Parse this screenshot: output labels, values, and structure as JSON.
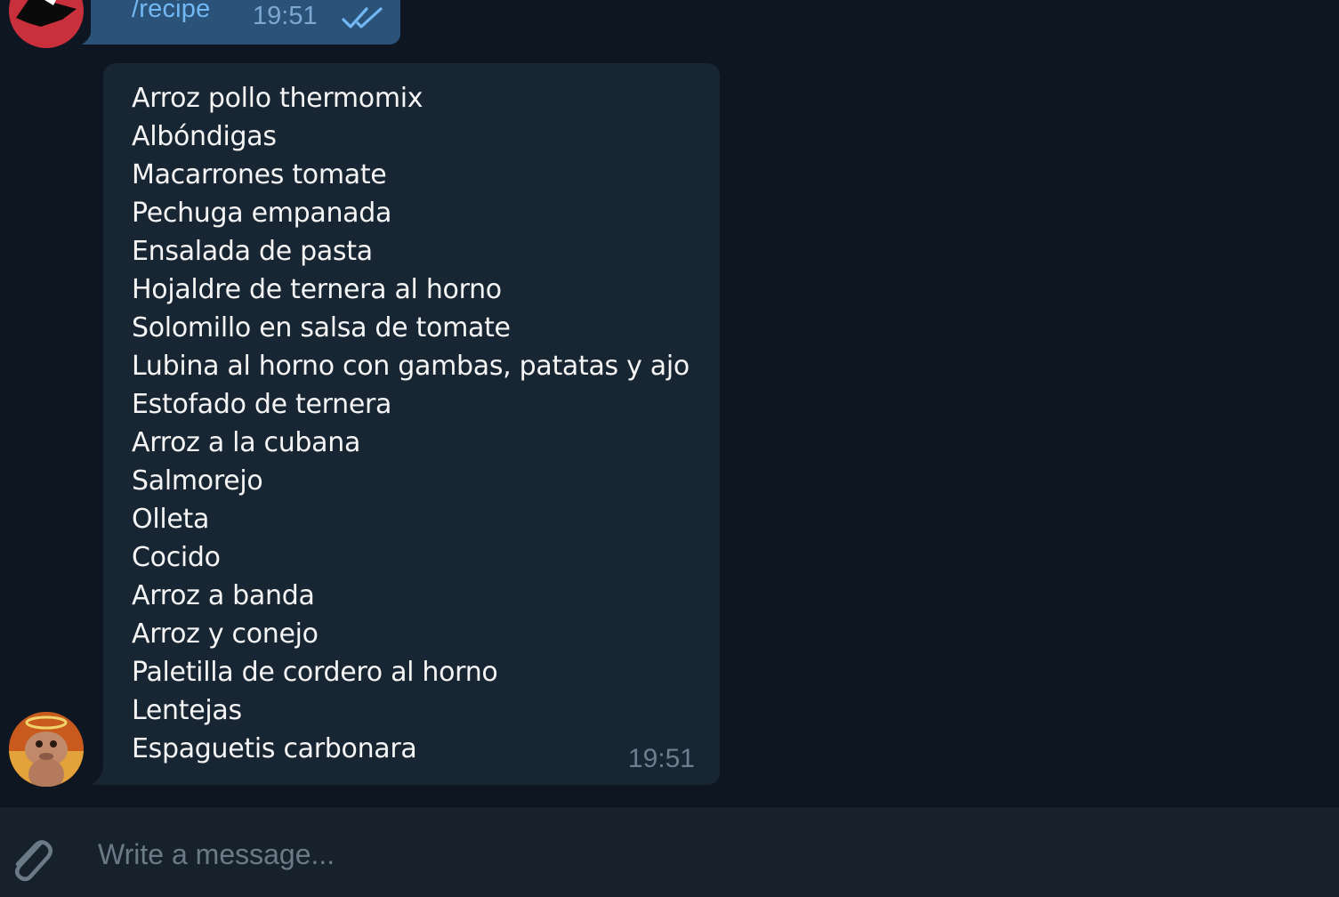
{
  "messages": {
    "outgoing": {
      "text": "/recipe",
      "time": "19:51",
      "status_icon": "double-check-icon"
    },
    "incoming": {
      "items": [
        "Arroz pollo thermomix",
        "Albóndigas",
        "Macarrones tomate",
        "Pechuga empanada",
        "Ensalada de pasta",
        "Hojaldre de ternera al horno",
        "Solomillo en salsa de tomate",
        "Lubina al horno con gambas, patatas y ajo",
        "Estofado de ternera",
        "Arroz a la cubana",
        "Salmorejo",
        "Olleta",
        "Cocido",
        "Arroz a banda",
        "Arroz y conejo",
        "Paletilla de cordero al horno",
        "Lentejas",
        "Espaguetis carbonara"
      ],
      "time": "19:51"
    }
  },
  "composer": {
    "placeholder": "Write a message...",
    "value": "",
    "attach_icon": "paperclip-icon"
  },
  "colors": {
    "chat_background": "#0e1621",
    "outgoing_bubble": "#2b5278",
    "incoming_bubble": "#182533",
    "composer_background": "#17212b",
    "command_link": "#71b8f5",
    "message_text": "#f5f5f5",
    "timestamp_incoming": "#6d7f8f"
  }
}
